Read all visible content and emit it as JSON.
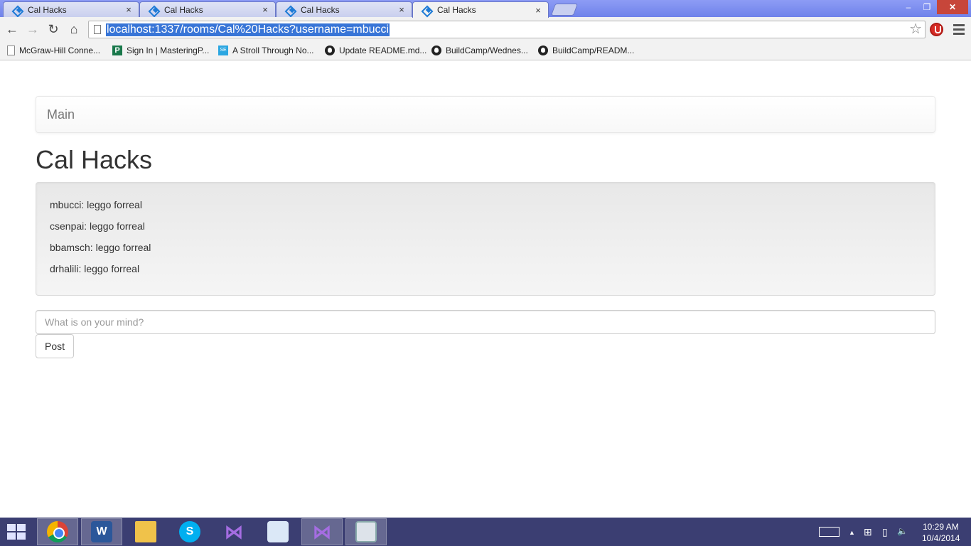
{
  "browser": {
    "tabs": [
      {
        "title": "Cal Hacks",
        "active": false
      },
      {
        "title": "Cal Hacks",
        "active": false
      },
      {
        "title": "Cal Hacks",
        "active": false
      },
      {
        "title": "Cal Hacks",
        "active": true
      }
    ],
    "tab_close_glyph": "×",
    "window_controls": {
      "minimize": "–",
      "maximize": "❐",
      "close": "✕"
    },
    "nav": {
      "back": "←",
      "forward": "→",
      "reload": "↻",
      "home": "⌂"
    },
    "url": "localhost:1337/rooms/Cal%20Hacks?username=mbucci",
    "bookmark_star": "☆",
    "bookmarks": [
      {
        "label": "McGraw-Hill Conne...",
        "icon": "page-icon"
      },
      {
        "label": "Sign In | MasteringP...",
        "icon": "pearson-icon"
      },
      {
        "label": "A Stroll Through No...",
        "icon": "se-icon"
      },
      {
        "label": "Update README.md...",
        "icon": "github-icon"
      },
      {
        "label": "BuildCamp/Wednes...",
        "icon": "github-icon"
      },
      {
        "label": "BuildCamp/READM...",
        "icon": "github-icon"
      }
    ],
    "bookmark_glyphs": {
      "pearson": "P",
      "se": "SE"
    }
  },
  "page": {
    "navbar_brand": "Main",
    "room_title": "Cal Hacks",
    "messages": [
      "mbucci: leggo forreal",
      "csenpai: leggo forreal",
      "bbamsch: leggo forreal",
      "drhalili: leggo forreal"
    ],
    "input_placeholder": "What is on your mind?",
    "post_button": "Post"
  },
  "taskbar": {
    "apps": [
      "chrome-icon",
      "word-icon",
      "file-explorer-icon",
      "skype-icon",
      "visual-studio-icon",
      "bird-app-icon",
      "visual-studio-icon",
      "window-app-icon"
    ],
    "glyphs": {
      "word": "W",
      "skype": "S",
      "vs": "⋈"
    },
    "tray_glyphs": {
      "up": "▲",
      "network": "⊞",
      "battery": "▯",
      "volume": "🔈"
    },
    "time": "10:29 AM",
    "date": "10/4/2014"
  },
  "colors": {
    "titlebar": "#7b8cf0",
    "url_highlight": "#3875d7",
    "taskbar": "#3b3e72"
  }
}
